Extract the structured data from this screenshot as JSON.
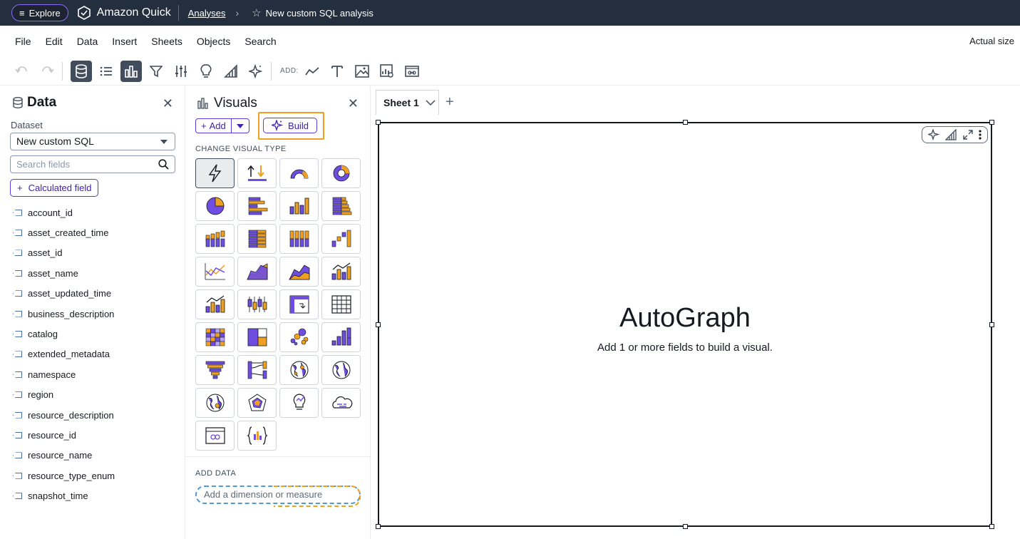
{
  "topbar": {
    "explore_label": "Explore",
    "brand": "Amazon Quick",
    "breadcrumb_link": "Analyses",
    "analysis_title": "New custom SQL analysis",
    "accent": "#8b6bf2"
  },
  "menubar": {
    "items": [
      "File",
      "Edit",
      "Data",
      "Insert",
      "Sheets",
      "Objects",
      "Search"
    ],
    "actual_size": "Actual size"
  },
  "toolbar": {
    "add_label": "ADD:",
    "buttons": [
      "undo-icon",
      "redo-icon",
      "dataset-icon",
      "list-icon",
      "visuals-icon",
      "filter-icon",
      "parameters-icon",
      "insights-icon",
      "themes-icon",
      "sparkle-icon"
    ],
    "add_buttons": [
      "add-visual-icon",
      "add-text-icon",
      "add-image-icon",
      "add-insight-icon",
      "add-embed-icon"
    ]
  },
  "data_panel": {
    "title": "Data",
    "dataset_label": "Dataset",
    "dataset_value": "New custom SQL",
    "search_placeholder": "Search fields",
    "calculated_field": "Calculated field",
    "fields": [
      "account_id",
      "asset_created_time",
      "asset_id",
      "asset_name",
      "asset_updated_time",
      "business_description",
      "catalog",
      "extended_metadata",
      "namespace",
      "region",
      "resource_description",
      "resource_id",
      "resource_name",
      "resource_type_enum",
      "snapshot_time"
    ]
  },
  "visuals_panel": {
    "title": "Visuals",
    "add_label": "Add",
    "build_label": "Build",
    "change_visual_type": "CHANGE VISUAL TYPE",
    "add_data": "ADD DATA",
    "add_dimension_placeholder": "Add a dimension or measure",
    "visual_types": [
      "autograph",
      "kpi",
      "gauge",
      "donut",
      "pie",
      "horizontal-bar",
      "vertical-bar",
      "horizontal-stacked-bar",
      "vertical-stacked-bar",
      "horizontal-100-bar",
      "vertical-100-bar",
      "waterfall",
      "line",
      "area",
      "stacked-area",
      "bar-and-line",
      "clustered-bar-combo",
      "box-plot",
      "pivot-table",
      "table",
      "heat-map",
      "tree-map",
      "scatter",
      "histogram",
      "funnel",
      "sankey",
      "points-on-map",
      "filled-map",
      "layer-map",
      "radar",
      "insight",
      "word-cloud",
      "embed",
      "custom-visual"
    ],
    "highlight_color": "#f0a020"
  },
  "sheet": {
    "tab_label": "Sheet 1",
    "visual_title": "AutoGraph",
    "visual_subtitle": "Add 1 or more fields to build a visual."
  }
}
